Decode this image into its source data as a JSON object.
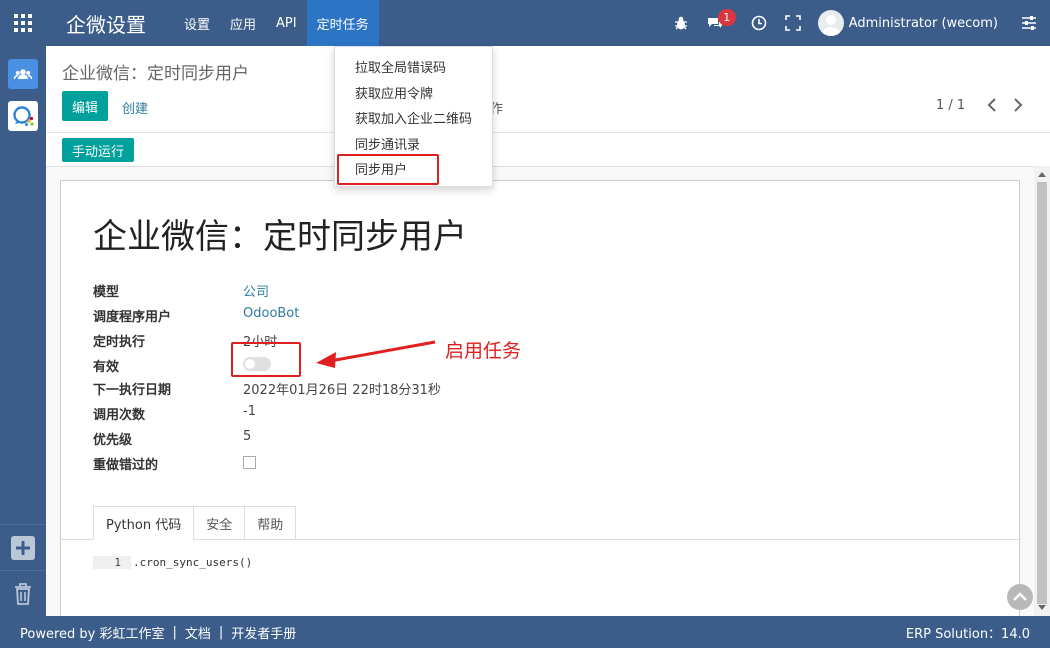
{
  "navbar": {
    "brand": "企微设置",
    "menu": [
      "设置",
      "应用",
      "API",
      "定时任务"
    ],
    "active_menu": "定时任务",
    "notification_count": "1",
    "user_name": "Administrator (wecom)"
  },
  "dropdown": {
    "items": [
      "拉取全局错误码",
      "获取应用令牌",
      "获取加入企业二维码",
      "同步通讯录",
      "同步用户"
    ],
    "highlighted": "同步用户"
  },
  "control_panel": {
    "breadcrumb": "企业微信：定时同步用户",
    "edit_button": "编辑",
    "create_button": "创建",
    "action_partial": "作",
    "pager": "1 / 1"
  },
  "statusbar": {
    "run_button": "手动运行"
  },
  "form": {
    "title": "企业微信：定时同步用户",
    "fields": {
      "model": {
        "label": "模型",
        "value": "公司"
      },
      "user": {
        "label": "调度程序用户",
        "value": "OdooBot"
      },
      "interval": {
        "label": "定时执行",
        "value": "2小时"
      },
      "active": {
        "label": "有效",
        "checked": false
      },
      "nextcall": {
        "label": "下一执行日期",
        "value": "2022年01月26日 22时18分31秒"
      },
      "numbercall": {
        "label": "调用次数",
        "value": "-1"
      },
      "priority": {
        "label": "优先级",
        "value": "5"
      },
      "doall": {
        "label": "重做错过的",
        "checked": false
      }
    },
    "tabs": [
      "Python 代码",
      "安全",
      "帮助"
    ],
    "code_line_number": "1",
    "code": ".cron_sync_users()"
  },
  "annotation": {
    "text": "启用任务",
    "color": "#e02020"
  },
  "footer": {
    "powered": "Powered by 彩虹工作室",
    "docs": "文档",
    "dev_manual": "开发者手册",
    "version": "ERP Solution：14.0"
  },
  "colors": {
    "navbar": "#3c5d8a",
    "active_menu": "#2c74c4",
    "primary": "#00a09d",
    "link": "#2c7da0"
  }
}
